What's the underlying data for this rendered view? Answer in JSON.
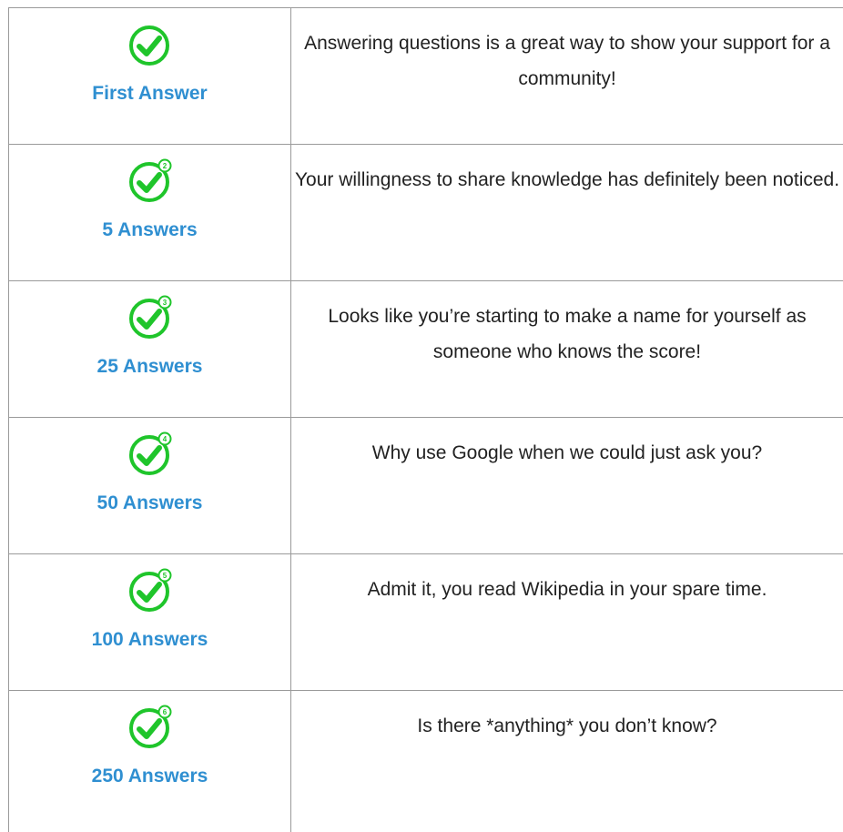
{
  "colors": {
    "title": "#2f8fd1",
    "check": "#1fc52b",
    "border": "#9a9a9a",
    "text": "#222222"
  },
  "badges": [
    {
      "icon": "green-check-circle-icon",
      "title": "First Answer",
      "description": "Answering questions is a great way to show your support for a community!"
    },
    {
      "icon": "green-check-circle-level-2-icon",
      "title": "5 Answers",
      "description": "Your willingness to share knowledge has definitely been noticed.",
      "level": "2"
    },
    {
      "icon": "green-check-circle-level-3-icon",
      "title": "25 Answers",
      "description": "Looks like you’re starting to make a name for yourself as someone who knows the score!",
      "level": "3"
    },
    {
      "icon": "green-check-circle-level-4-icon",
      "title": "50 Answers",
      "description": "Why use Google when we could just ask you?",
      "level": "4"
    },
    {
      "icon": "green-check-circle-level-5-icon",
      "title": "100 Answers",
      "description": "Admit it, you read Wikipedia in your spare time.",
      "level": "5"
    },
    {
      "icon": "green-check-circle-level-6-icon",
      "title": "250 Answers",
      "description": "Is there *anything* you don’t know?",
      "level": "6"
    }
  ]
}
